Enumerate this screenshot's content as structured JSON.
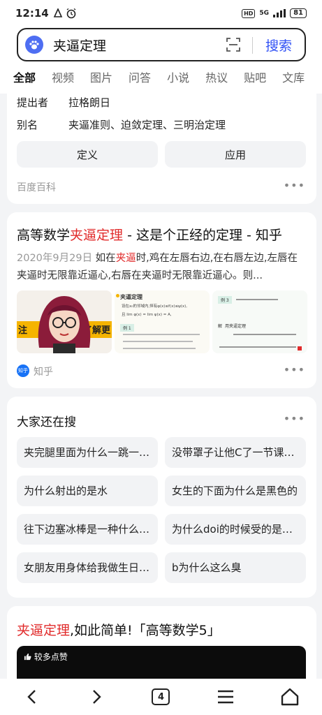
{
  "status_bar": {
    "time": "12:14",
    "hd": "HD",
    "signal": "5G",
    "battery": "81"
  },
  "search": {
    "query": "夹逼定理",
    "button": "搜索"
  },
  "tabs": [
    "全部",
    "视频",
    "图片",
    "问答",
    "小说",
    "热议",
    "贴吧",
    "文库"
  ],
  "baike_card": {
    "rows": [
      {
        "key": "提出者",
        "value": "拉格朗日"
      },
      {
        "key": "别名",
        "value": "夹逼准则、迫敛定理、三明治定理"
      }
    ],
    "buttons": [
      "定义",
      "应用"
    ],
    "source": "百度百科"
  },
  "zhihu_card": {
    "title_prefix": "高等数学",
    "title_highlight": "夹逼定理",
    "title_suffix": " - 这是个正经的定理 - 知乎",
    "date": "2020年9月29日",
    "desc_1": "  如在",
    "desc_hl": "夹逼",
    "desc_2": "时,鸡在左唇右边,在右唇左边,左唇在夹逼时无限靠近逼心,右唇在夹逼时无限靠近逼心。则...",
    "thumb1_left": "注",
    "thumb1_right": "了解更",
    "thumb2_header": "夹逼定理",
    "thumb2_line1": "设在x₀的邻域内,恒有φ(x)≤f(x)≤ψ(x),",
    "thumb2_line2": "且 lim φ(x) = lim ψ(x) = A,",
    "thumb2_example": "例 1",
    "thumb3_example": "例 3",
    "thumb3_solution": "解",
    "thumb3_text": "用夹逼定理",
    "source": "知乎",
    "source_badge": "知乎"
  },
  "related": {
    "title": "大家还在搜",
    "items": [
      "夹完腿里面为什么一跳一跳的",
      "没带罩子让他C了一节课作文",
      "为什么射出的是水",
      "女生的下面为什么是黑色的",
      "往下边塞冰棒是一种什么体验",
      "为什么doi的时候受的是哪方",
      "女朋友用身体给我做生日礼物",
      "b为什么这么臭"
    ]
  },
  "video_card": {
    "title_highlight": "夹逼定理",
    "title_rest": ",如此简单!「高等数学5」",
    "badge": "较多点赞"
  },
  "bottom_nav": {
    "tab_count": "4"
  }
}
